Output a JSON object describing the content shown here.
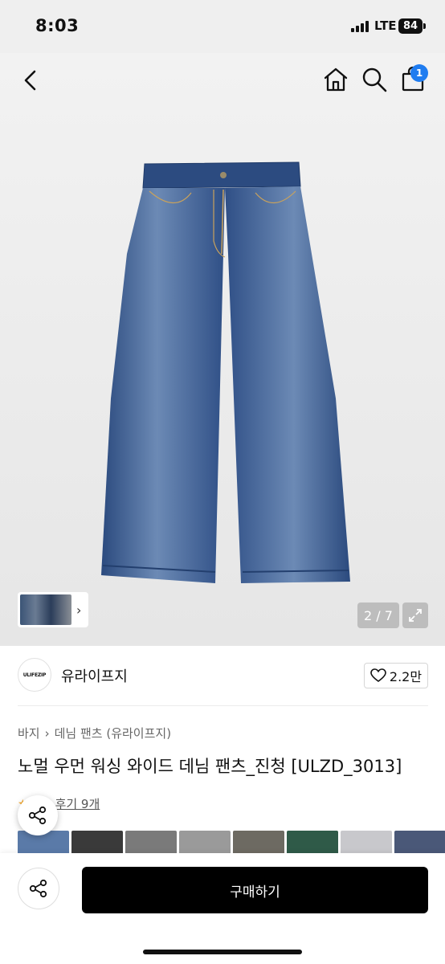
{
  "status_bar": {
    "time": "8:03",
    "network": "LTE",
    "battery": "84"
  },
  "header": {
    "back_icon": "chevron-left-icon",
    "home_icon": "home-icon",
    "search_icon": "search-icon",
    "bag_icon": "shopping-bag-icon",
    "cart_count": "1"
  },
  "gallery": {
    "page_indicator": "2 / 7",
    "thumbnail_chevron": "›",
    "expand_icon": "expand-icon"
  },
  "brand": {
    "logo_text": "ULIFEZIP",
    "name": "유라이프지",
    "like_count": "2.2만"
  },
  "product": {
    "breadcrumb": [
      "바지",
      "데님 팬츠 (유라이프지)"
    ],
    "breadcrumb_separator": "›",
    "title": "노멀 우먼 워싱 와이드 데님 팬츠_진청 [ULZD_3013]",
    "review_label": "후기 9개"
  },
  "review_photo_colors": [
    "#5a7aa8",
    "#3a3a3a",
    "#7a7a7a",
    "#9a9a9a",
    "#6d6a62",
    "#2f5a48",
    "#c8c8cc",
    "#4a5878",
    "#2a2a2a"
  ],
  "bottom_bar": {
    "buy_label": "구매하기",
    "share_icon": "share-icon"
  },
  "colors": {
    "badge": "#1f7cf0",
    "buy_button": "#000000",
    "denim": "#2f4f86"
  }
}
